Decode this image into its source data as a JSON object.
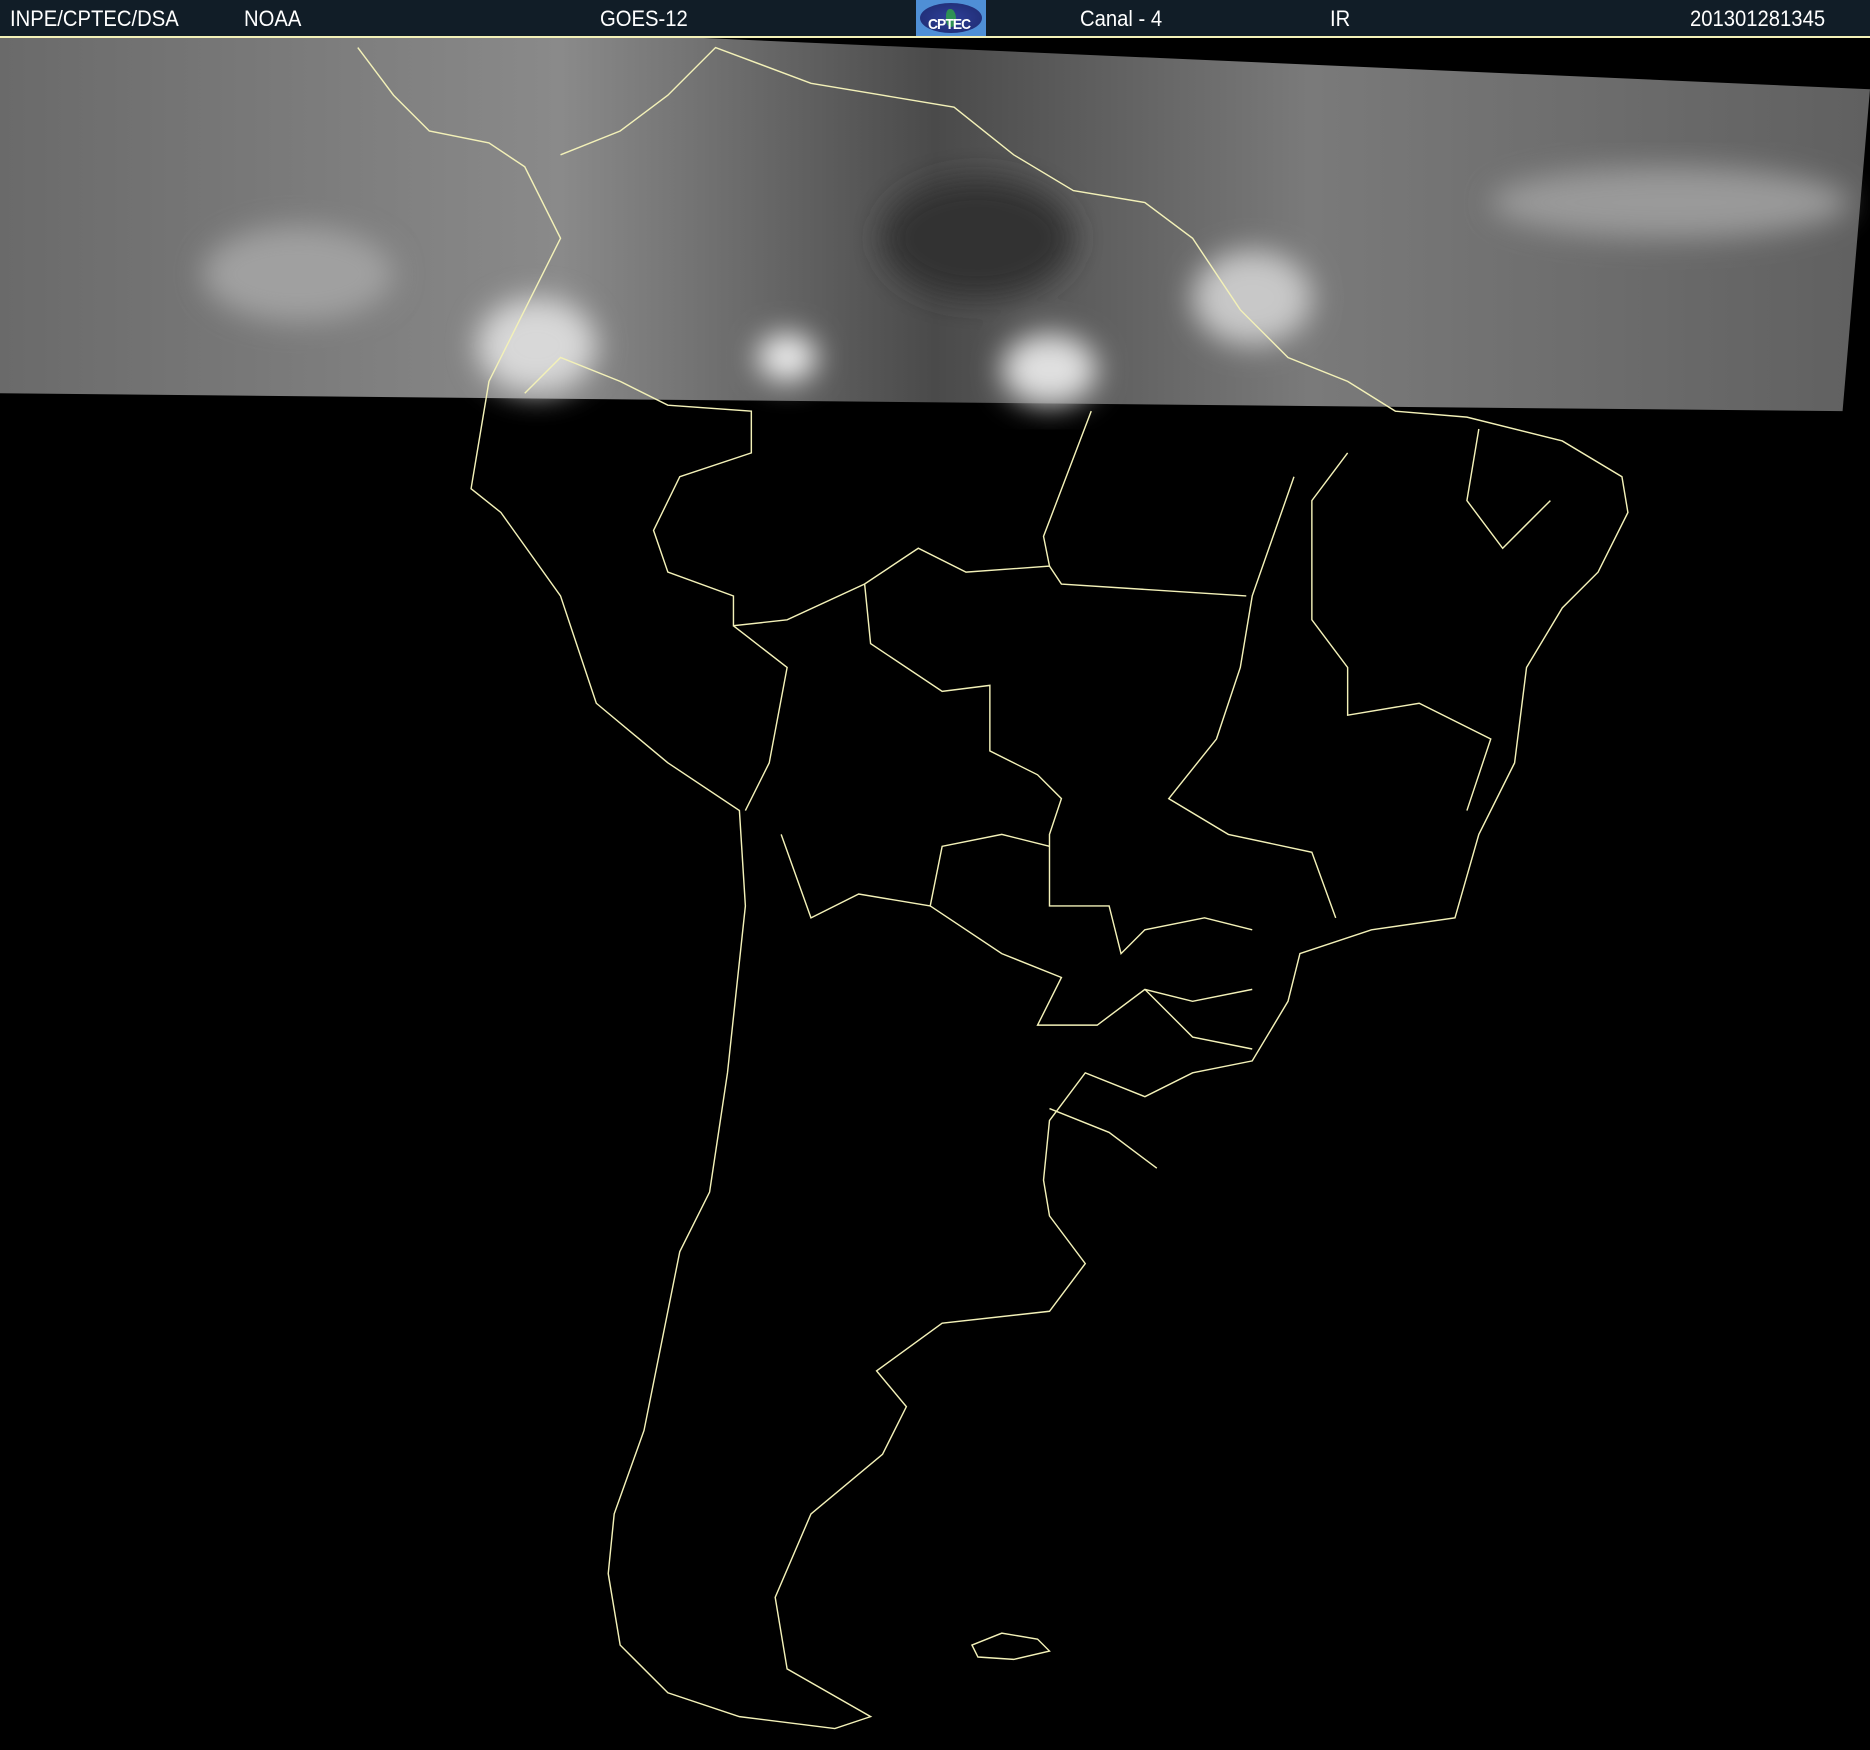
{
  "header": {
    "source": "INPE/CPTEC/DSA",
    "agency": "NOAA",
    "satellite": "GOES-12",
    "logo_text": "CPTEC",
    "channel": "Canal - 4",
    "band": "IR",
    "timestamp": "201301281345"
  },
  "colors": {
    "header_bg": "#111d27",
    "outline": "#f3f1b8",
    "background": "#000000"
  }
}
